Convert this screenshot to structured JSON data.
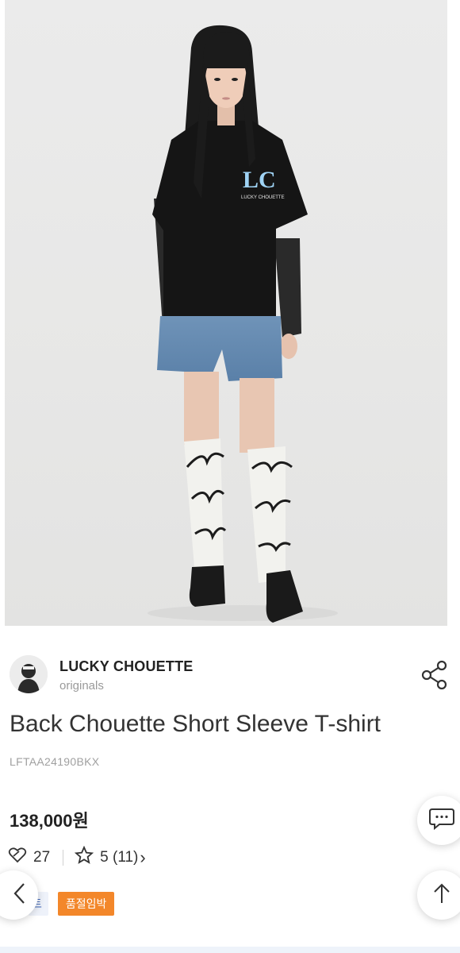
{
  "brand": {
    "name": "LUCKY CHOUETTE",
    "sub": "originals"
  },
  "product": {
    "title": "Back Chouette Short Sleeve T-shirt",
    "code": "LFTAA24190BKX",
    "price": "138,000원",
    "likes": "27",
    "rating": "5 (11)",
    "chevron": "›",
    "tags": [
      "트",
      "품절임박"
    ],
    "shirt_logo": "LC",
    "shirt_logo_sub": "LUCKY CHOUETTE"
  },
  "icons": {
    "share": "share-icon",
    "heart": "heart-icon",
    "star": "star-icon",
    "chat": "chat-icon",
    "up": "arrow-up-icon",
    "back": "chevron-left-icon"
  },
  "colors": {
    "tag_orange": "#f3872a",
    "tag_blue_text": "#3c63b5",
    "price": "#222222"
  }
}
